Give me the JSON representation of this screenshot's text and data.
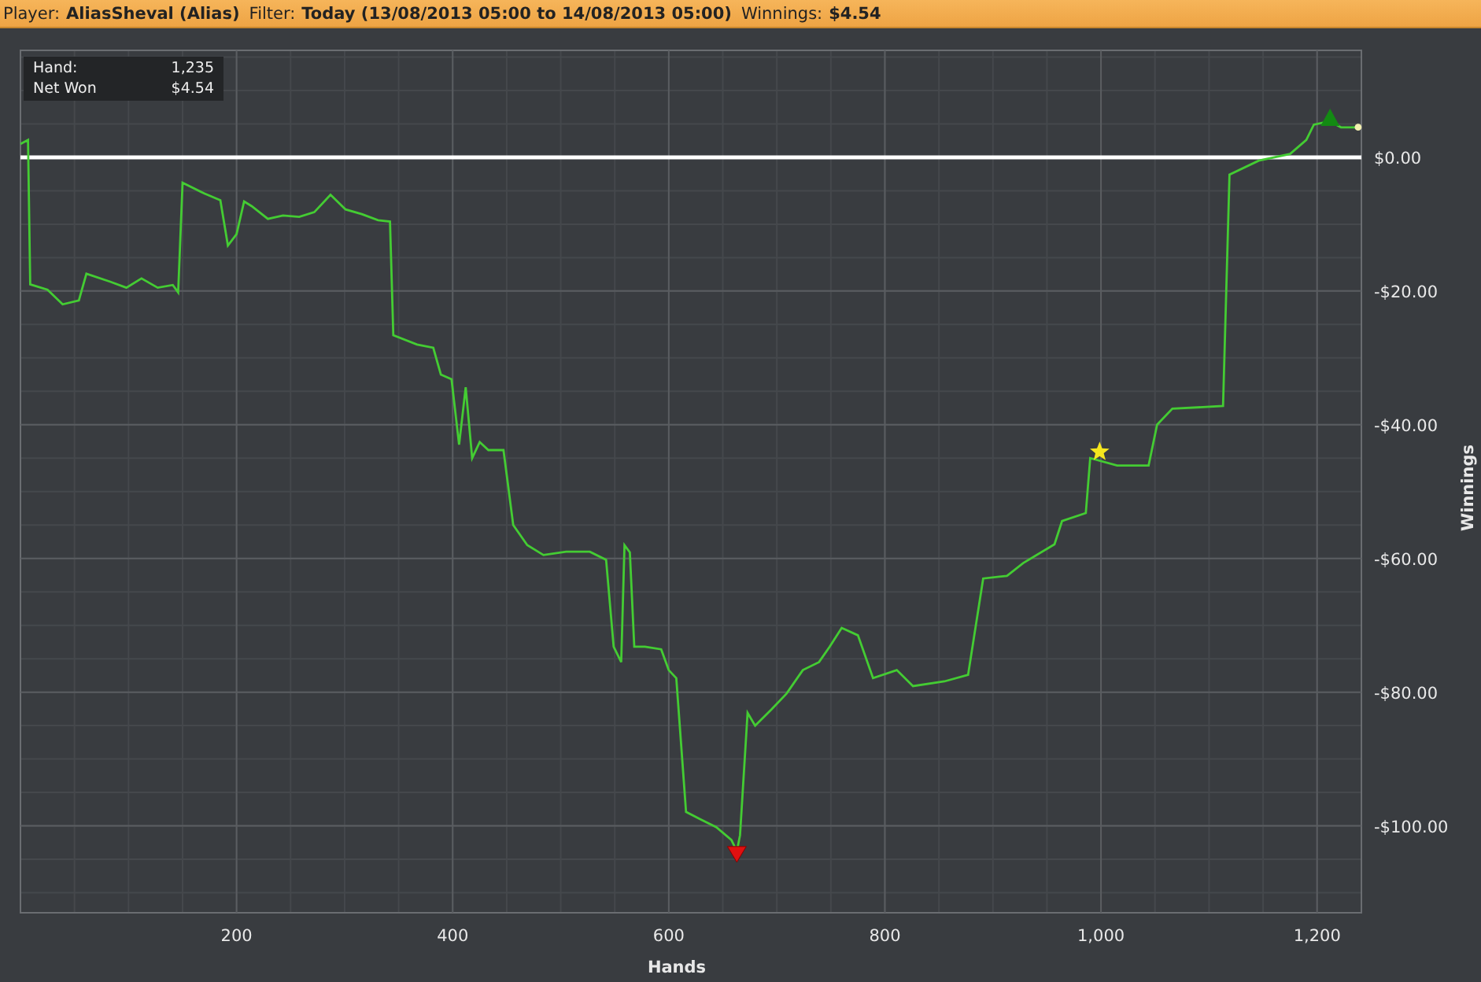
{
  "header": [
    {
      "label": "Player:",
      "value": "AliasSheval (Alias)"
    },
    {
      "label": "Filter:",
      "value": "Today (13/08/2013 05:00 to 14/08/2013 05:00)"
    },
    {
      "label": "Winnings:",
      "value": "$4.54"
    }
  ],
  "tooltip": [
    {
      "label": "Hand:",
      "value": "1,235"
    },
    {
      "label": "Net Won",
      "value": "$4.54"
    }
  ],
  "chart_data": {
    "type": "line",
    "xlabel": "Hands",
    "ylabel": "Winnings",
    "xlim": [
      0,
      1241
    ],
    "ylim": [
      -113,
      16
    ],
    "xticks": [
      {
        "value": 200,
        "label": "200"
      },
      {
        "value": 400,
        "label": "400"
      },
      {
        "value": 600,
        "label": "600"
      },
      {
        "value": 800,
        "label": "800"
      },
      {
        "value": 1000,
        "label": "1,000"
      },
      {
        "value": 1200,
        "label": "1,200"
      }
    ],
    "yticks": [
      {
        "value": 0,
        "label": "$0.00"
      },
      {
        "value": -20,
        "label": "-$20.00"
      },
      {
        "value": -40,
        "label": "-$40.00"
      },
      {
        "value": -60,
        "label": "-$60.00"
      },
      {
        "value": -80,
        "label": "-$80.00"
      },
      {
        "value": -100,
        "label": "-$100.00"
      }
    ],
    "x": [
      0,
      7,
      9,
      25,
      39,
      54,
      61,
      83,
      98,
      112,
      127,
      141,
      146,
      150,
      170,
      185,
      192,
      200,
      207,
      214,
      229,
      243,
      258,
      272,
      287,
      301,
      316,
      331,
      342,
      345,
      367,
      382,
      389,
      399,
      406,
      412,
      418,
      425,
      433,
      447,
      456,
      469,
      484,
      505,
      527,
      542,
      549,
      556,
      559,
      564,
      568,
      578,
      593,
      600,
      607,
      616,
      629,
      644,
      658,
      663,
      666,
      673,
      680,
      695,
      709,
      724,
      739,
      749,
      760,
      775,
      789,
      811,
      826,
      855,
      877,
      891,
      913,
      928,
      957,
      964,
      986,
      990,
      1015,
      1044,
      1052,
      1066,
      1113,
      1119,
      1146,
      1175,
      1190,
      1197,
      1212,
      1222,
      1238
    ],
    "series": [
      {
        "color": "#44cc33",
        "values": [
          2,
          2.6,
          -19,
          -19.8,
          -22,
          -21.4,
          -17.4,
          -18.6,
          -19.5,
          -18.1,
          -19.5,
          -19.1,
          -20.2,
          -3.8,
          -5.4,
          -6.4,
          -13.2,
          -11.5,
          -6.6,
          -7.3,
          -9.2,
          -8.7,
          -8.9,
          -8.2,
          -5.6,
          -7.8,
          -8.5,
          -9.4,
          -9.6,
          -26.6,
          -28,
          -28.5,
          -32.5,
          -33.2,
          -43,
          -34.4,
          -45,
          -42.6,
          -43.8,
          -43.8,
          -55,
          -58,
          -59.5,
          -59,
          -59,
          -60.2,
          -73.2,
          -75.5,
          -58,
          -59.1,
          -73.2,
          -73.2,
          -73.6,
          -76.7,
          -77.9,
          -97.9,
          -99,
          -100.2,
          -102.1,
          -103.8,
          -101.4,
          -83.1,
          -85,
          -82.6,
          -80.2,
          -76.7,
          -75.5,
          -73.2,
          -70.4,
          -71.5,
          -77.9,
          -76.7,
          -79.1,
          -78.4,
          -77.4,
          -63,
          -62.6,
          -60.7,
          -57.9,
          -54.4,
          -53.2,
          -45,
          -46.1,
          -46.1,
          -40,
          -37.6,
          -37.2,
          -2.6,
          -0.5,
          0.5,
          2.6,
          4.9,
          5.4,
          4.5,
          4.5
        ]
      }
    ],
    "grid": true
  }
}
